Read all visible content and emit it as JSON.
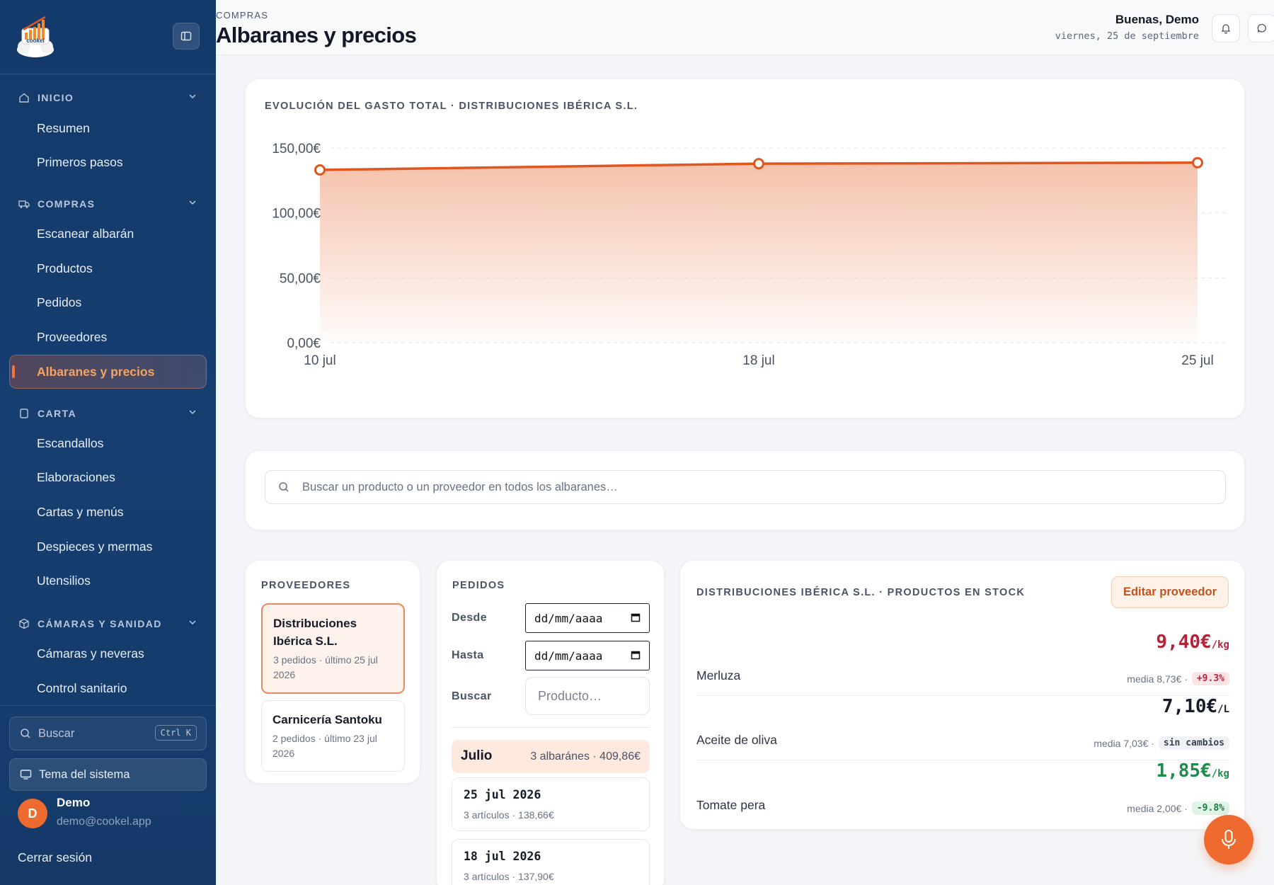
{
  "app": {
    "logo_text": "cookel"
  },
  "sidebar": {
    "sections": [
      {
        "label": "INICIO",
        "items": [
          "Resumen",
          "Primeros pasos"
        ]
      },
      {
        "label": "COMPRAS",
        "items": [
          "Escanear albarán",
          "Productos",
          "Pedidos",
          "Proveedores",
          "Albaranes y precios"
        ]
      },
      {
        "label": "CARTA",
        "items": [
          "Escandallos",
          "Elaboraciones",
          "Cartas y menús",
          "Despieces y mermas",
          "Utensilios"
        ]
      },
      {
        "label": "CÁMARAS Y SANIDAD",
        "items": [
          "Cámaras y neveras",
          "Control sanitario"
        ]
      }
    ],
    "active_item": "Albaranes y precios",
    "search_label": "Buscar",
    "search_shortcut": "Ctrl K",
    "theme_label": "Tema del sistema",
    "user": {
      "initial": "D",
      "name": "Demo",
      "email": "demo@cookel.app"
    },
    "logout_label": "Cerrar sesión"
  },
  "header": {
    "breadcrumb": "COMPRAS",
    "title": "Albaranes y precios",
    "greeting": "Buenas, Demo",
    "date": "viernes, 25 de septiembre"
  },
  "chart_card": {
    "title": "EVOLUCIÓN DEL GASTO TOTAL · DISTRIBUCIONES IBÉRICA S.L."
  },
  "chart_data": {
    "type": "area",
    "title": "EVOLUCIÓN DEL GASTO TOTAL · DISTRIBUCIONES IBÉRICA S.L.",
    "categories": [
      "10 jul",
      "18 jul",
      "25 jul"
    ],
    "values": [
      133.1,
      137.9,
      138.66
    ],
    "ylim": [
      0,
      150
    ],
    "yticks": [
      "0,00€",
      "50,00€",
      "100,00€",
      "150,00€"
    ],
    "ytick_values": [
      0,
      50,
      100,
      150
    ],
    "grid": true,
    "line_color": "#e0561f",
    "fill_color": "#f3b79d"
  },
  "search": {
    "placeholder": "Buscar un producto o un proveedor en todos los albaranes…"
  },
  "providers": {
    "title": "PROVEEDORES",
    "items": [
      {
        "name": "Distribuciones Ibérica S.L.",
        "meta": "3 pedidos · último 25 jul 2026",
        "selected": true
      },
      {
        "name": "Carnicería Santoku",
        "meta": "2 pedidos · último 23 jul 2026",
        "selected": false
      }
    ]
  },
  "orders": {
    "title": "PEDIDOS",
    "from_label": "Desde",
    "to_label": "Hasta",
    "search_label": "Buscar",
    "from_value": "dd/mm/aaaa",
    "to_value": "dd/mm/aaaa",
    "search_placeholder": "Producto…",
    "month": {
      "name": "Julio",
      "meta": "3 albaránes · 409,86€"
    },
    "items": [
      {
        "date": "25 jul 2026",
        "meta": "3 artículos · 138,66€"
      },
      {
        "date": "18 jul 2026",
        "meta": "3 artículos · 137,90€"
      }
    ]
  },
  "stock": {
    "title": "DISTRIBUCIONES IBÉRICA S.L. · PRODUCTOS EN STOCK",
    "edit_label": "Editar proveedor",
    "items": [
      {
        "name": "Merluza",
        "price": "9,40€",
        "unit": "/kg",
        "avg": "media 8,73€ ·",
        "change": "+9.3%",
        "color": "#b3243b",
        "chip_bg": "#fbe3e6",
        "chip_fg": "#b3243b"
      },
      {
        "name": "Aceite de oliva",
        "price": "7,10€",
        "unit": "/L",
        "avg": "media 7,03€ ·",
        "change": "sin cambios",
        "color": "#151b28",
        "chip_bg": "#f0f2f5",
        "chip_fg": "#3a4252"
      },
      {
        "name": "Tomate pera",
        "price": "1,85€",
        "unit": "/kg",
        "avg": "media 2,00€ ·",
        "change": "-9.8%",
        "color": "#1f8a4c",
        "chip_bg": "#dff3e6",
        "chip_fg": "#1f7a44"
      }
    ]
  },
  "colors": {
    "accent": "#ef6a2e",
    "sidebar": "#143a6b"
  },
  "icons": {
    "fab": "microphone-icon",
    "bell": "bell-icon",
    "chat": "chat-icon"
  }
}
